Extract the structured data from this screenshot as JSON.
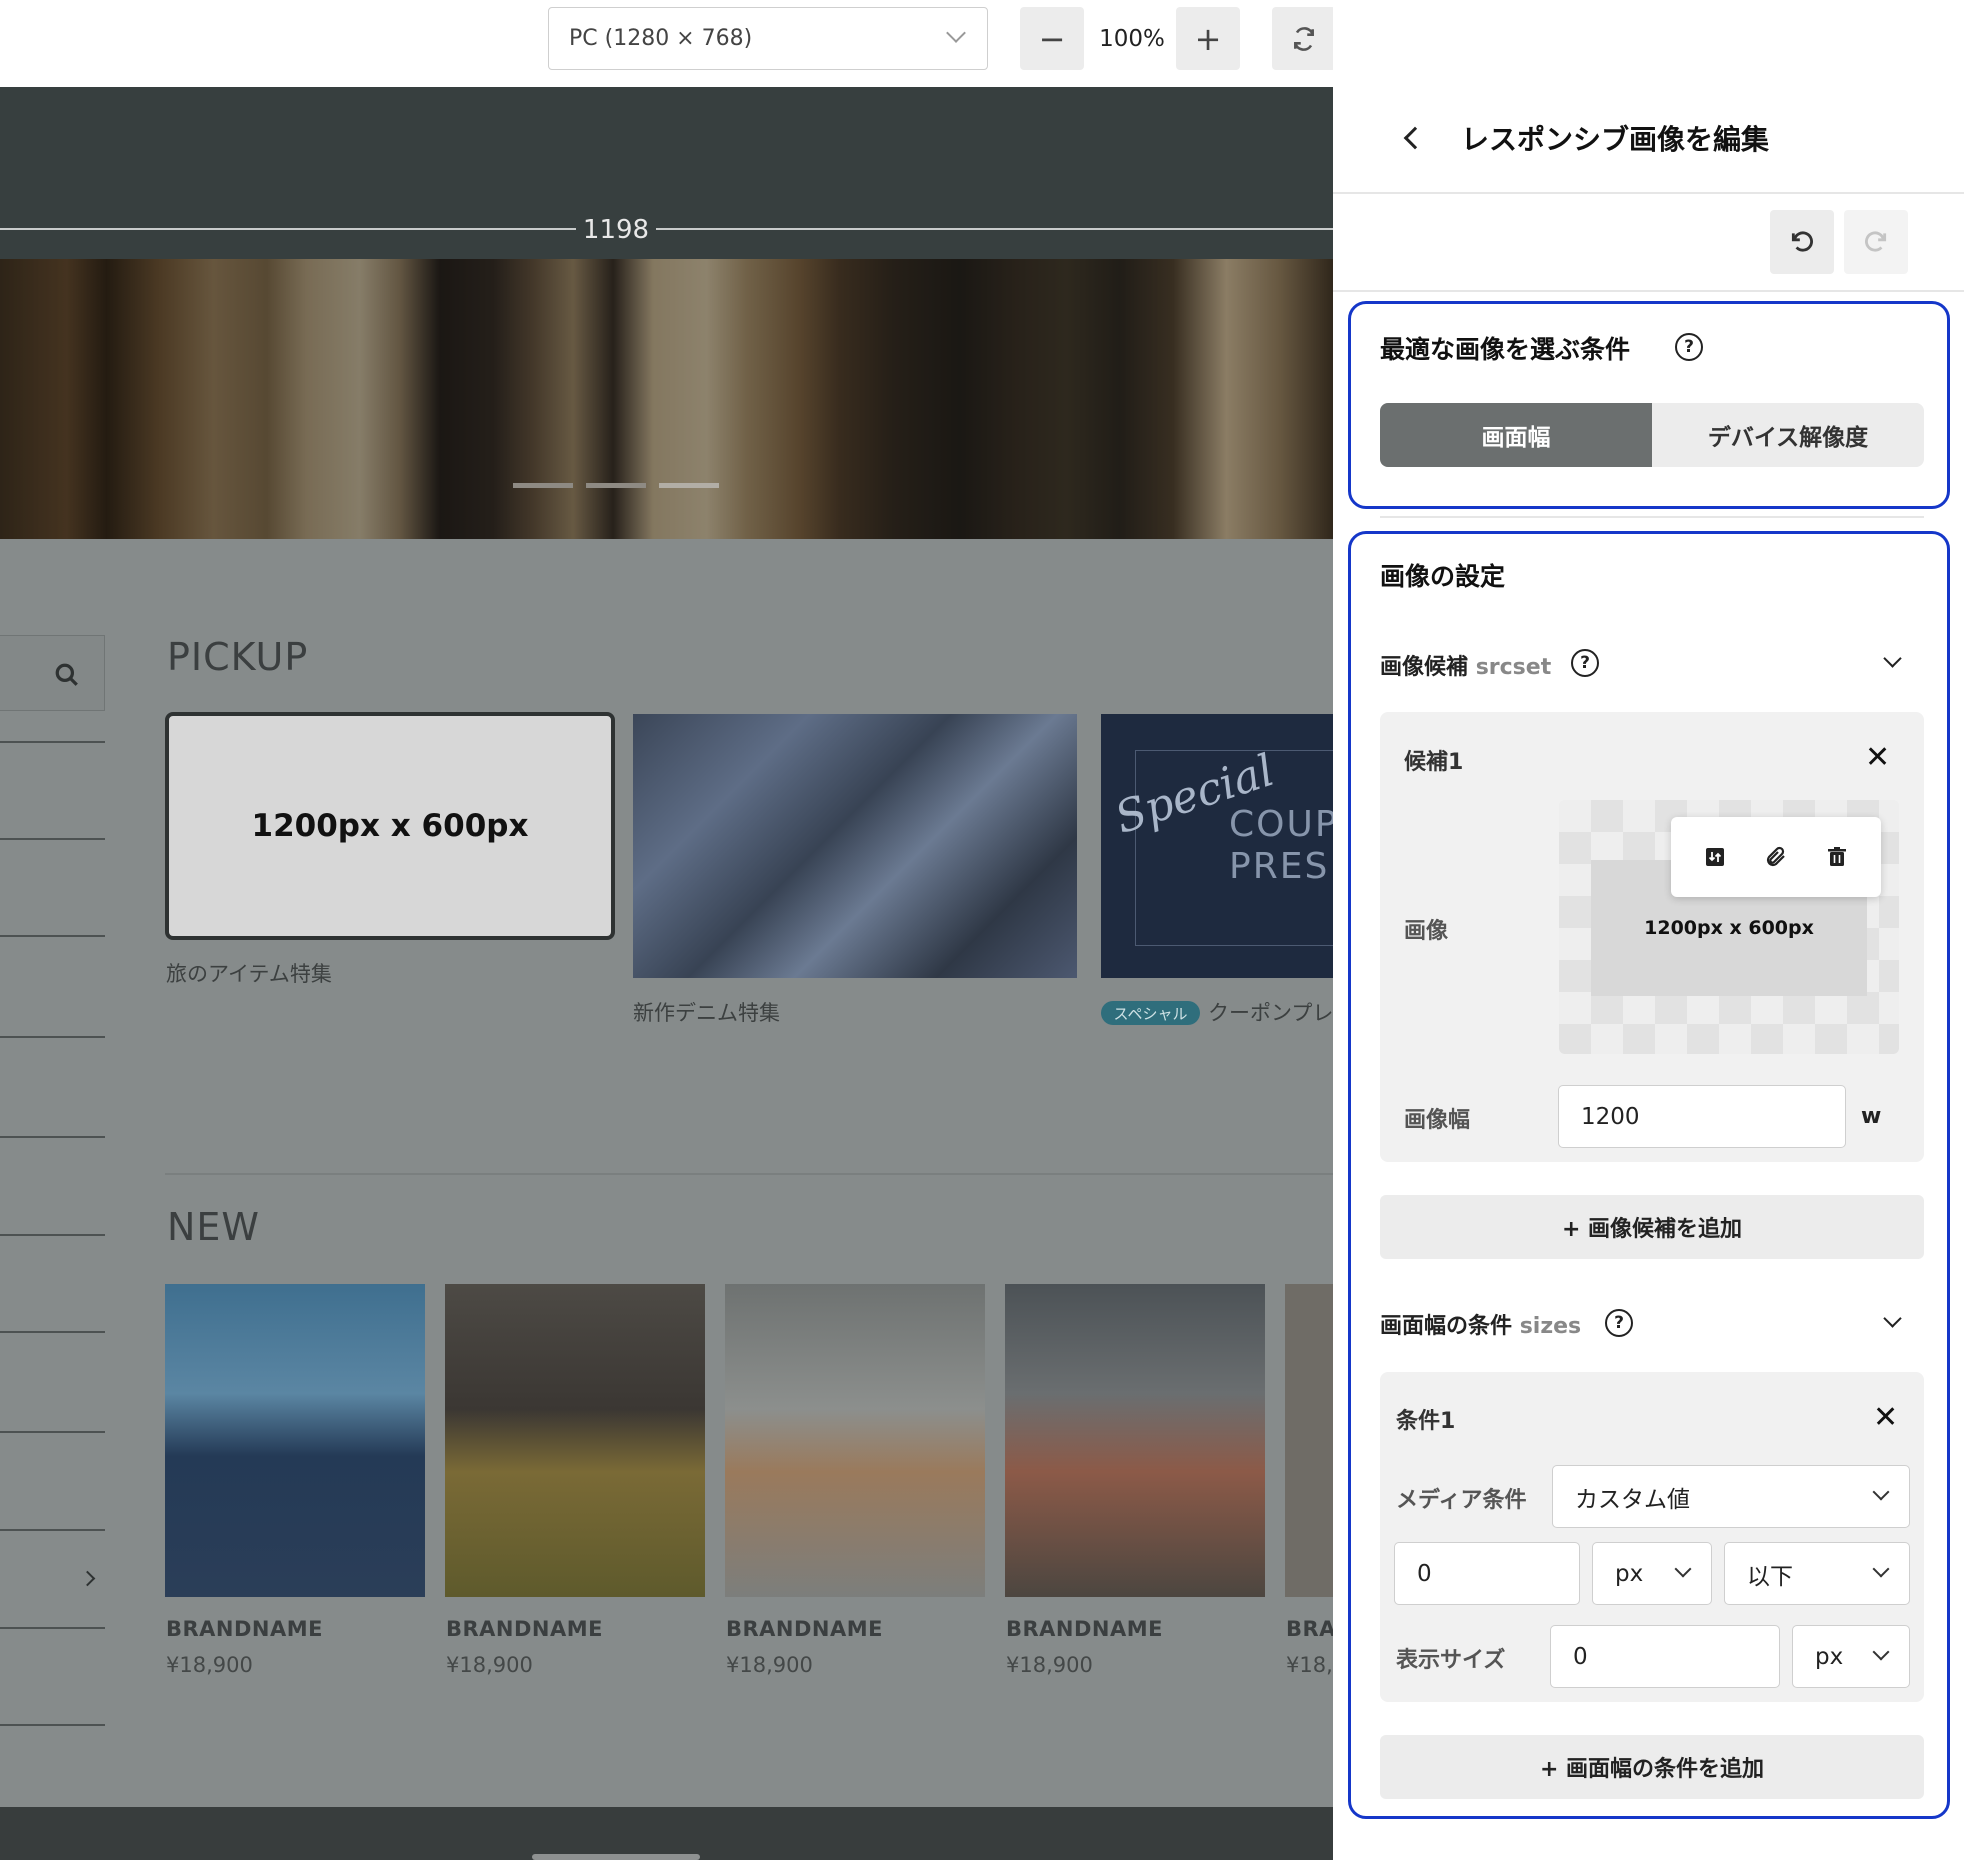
{
  "toolbar": {
    "device_select": "PC (1280 × 768)",
    "zoom_out_label": "−",
    "zoom_level": "100%",
    "zoom_in_label": "+",
    "reload_icon": "refresh-icon"
  },
  "preview": {
    "ruler_width": "1198",
    "pickup_title": "PICKUP",
    "pickup_items": [
      {
        "placeholder": "1200px x 600px",
        "caption": "旅のアイテム特集"
      },
      {
        "caption": "新作デニム特集"
      },
      {
        "badge": "スペシャル",
        "caption": "クーポンプレ",
        "image_text_script": "Special",
        "image_text_line1": "COUP",
        "image_text_line2": "PRES"
      }
    ],
    "new_title": "NEW",
    "products": [
      {
        "brand": "BRANDNAME",
        "price": "¥18,900"
      },
      {
        "brand": "BRANDNAME",
        "price": "¥18,900"
      },
      {
        "brand": "BRANDNAME",
        "price": "¥18,900"
      },
      {
        "brand": "BRANDNAME",
        "price": "¥18,900"
      },
      {
        "brand": "BRA",
        "price": "¥18,"
      }
    ]
  },
  "panel": {
    "title": "レスポンシブ画像を編集",
    "condition_section": {
      "title": "最適な画像を選ぶ条件",
      "tabs": [
        "画面幅",
        "デバイス解像度"
      ],
      "active_tab": "画面幅"
    },
    "image_settings": {
      "title": "画像の設定",
      "srcset_label": "画像候補",
      "srcset_code": "srcset",
      "candidate": {
        "title": "候補1",
        "image_label": "画像",
        "image_placeholder": "1200px x 600px",
        "width_label": "画像幅",
        "width_value": "1200",
        "width_unit": "w"
      },
      "add_candidate": "+ 画像候補を追加",
      "sizes_label": "画面幅の条件",
      "sizes_code": "sizes",
      "condition": {
        "title": "条件1",
        "media_label": "メディア条件",
        "media_value": "カスタム値",
        "value": "0",
        "unit": "px",
        "operator": "以下",
        "display_size_label": "表示サイズ",
        "display_size_value": "0",
        "display_size_unit": "px"
      },
      "add_condition": "+ 画面幅の条件を追加"
    }
  },
  "colors": {
    "accent_border": "#1537c9",
    "active_tab_bg": "#6b6f6f"
  }
}
